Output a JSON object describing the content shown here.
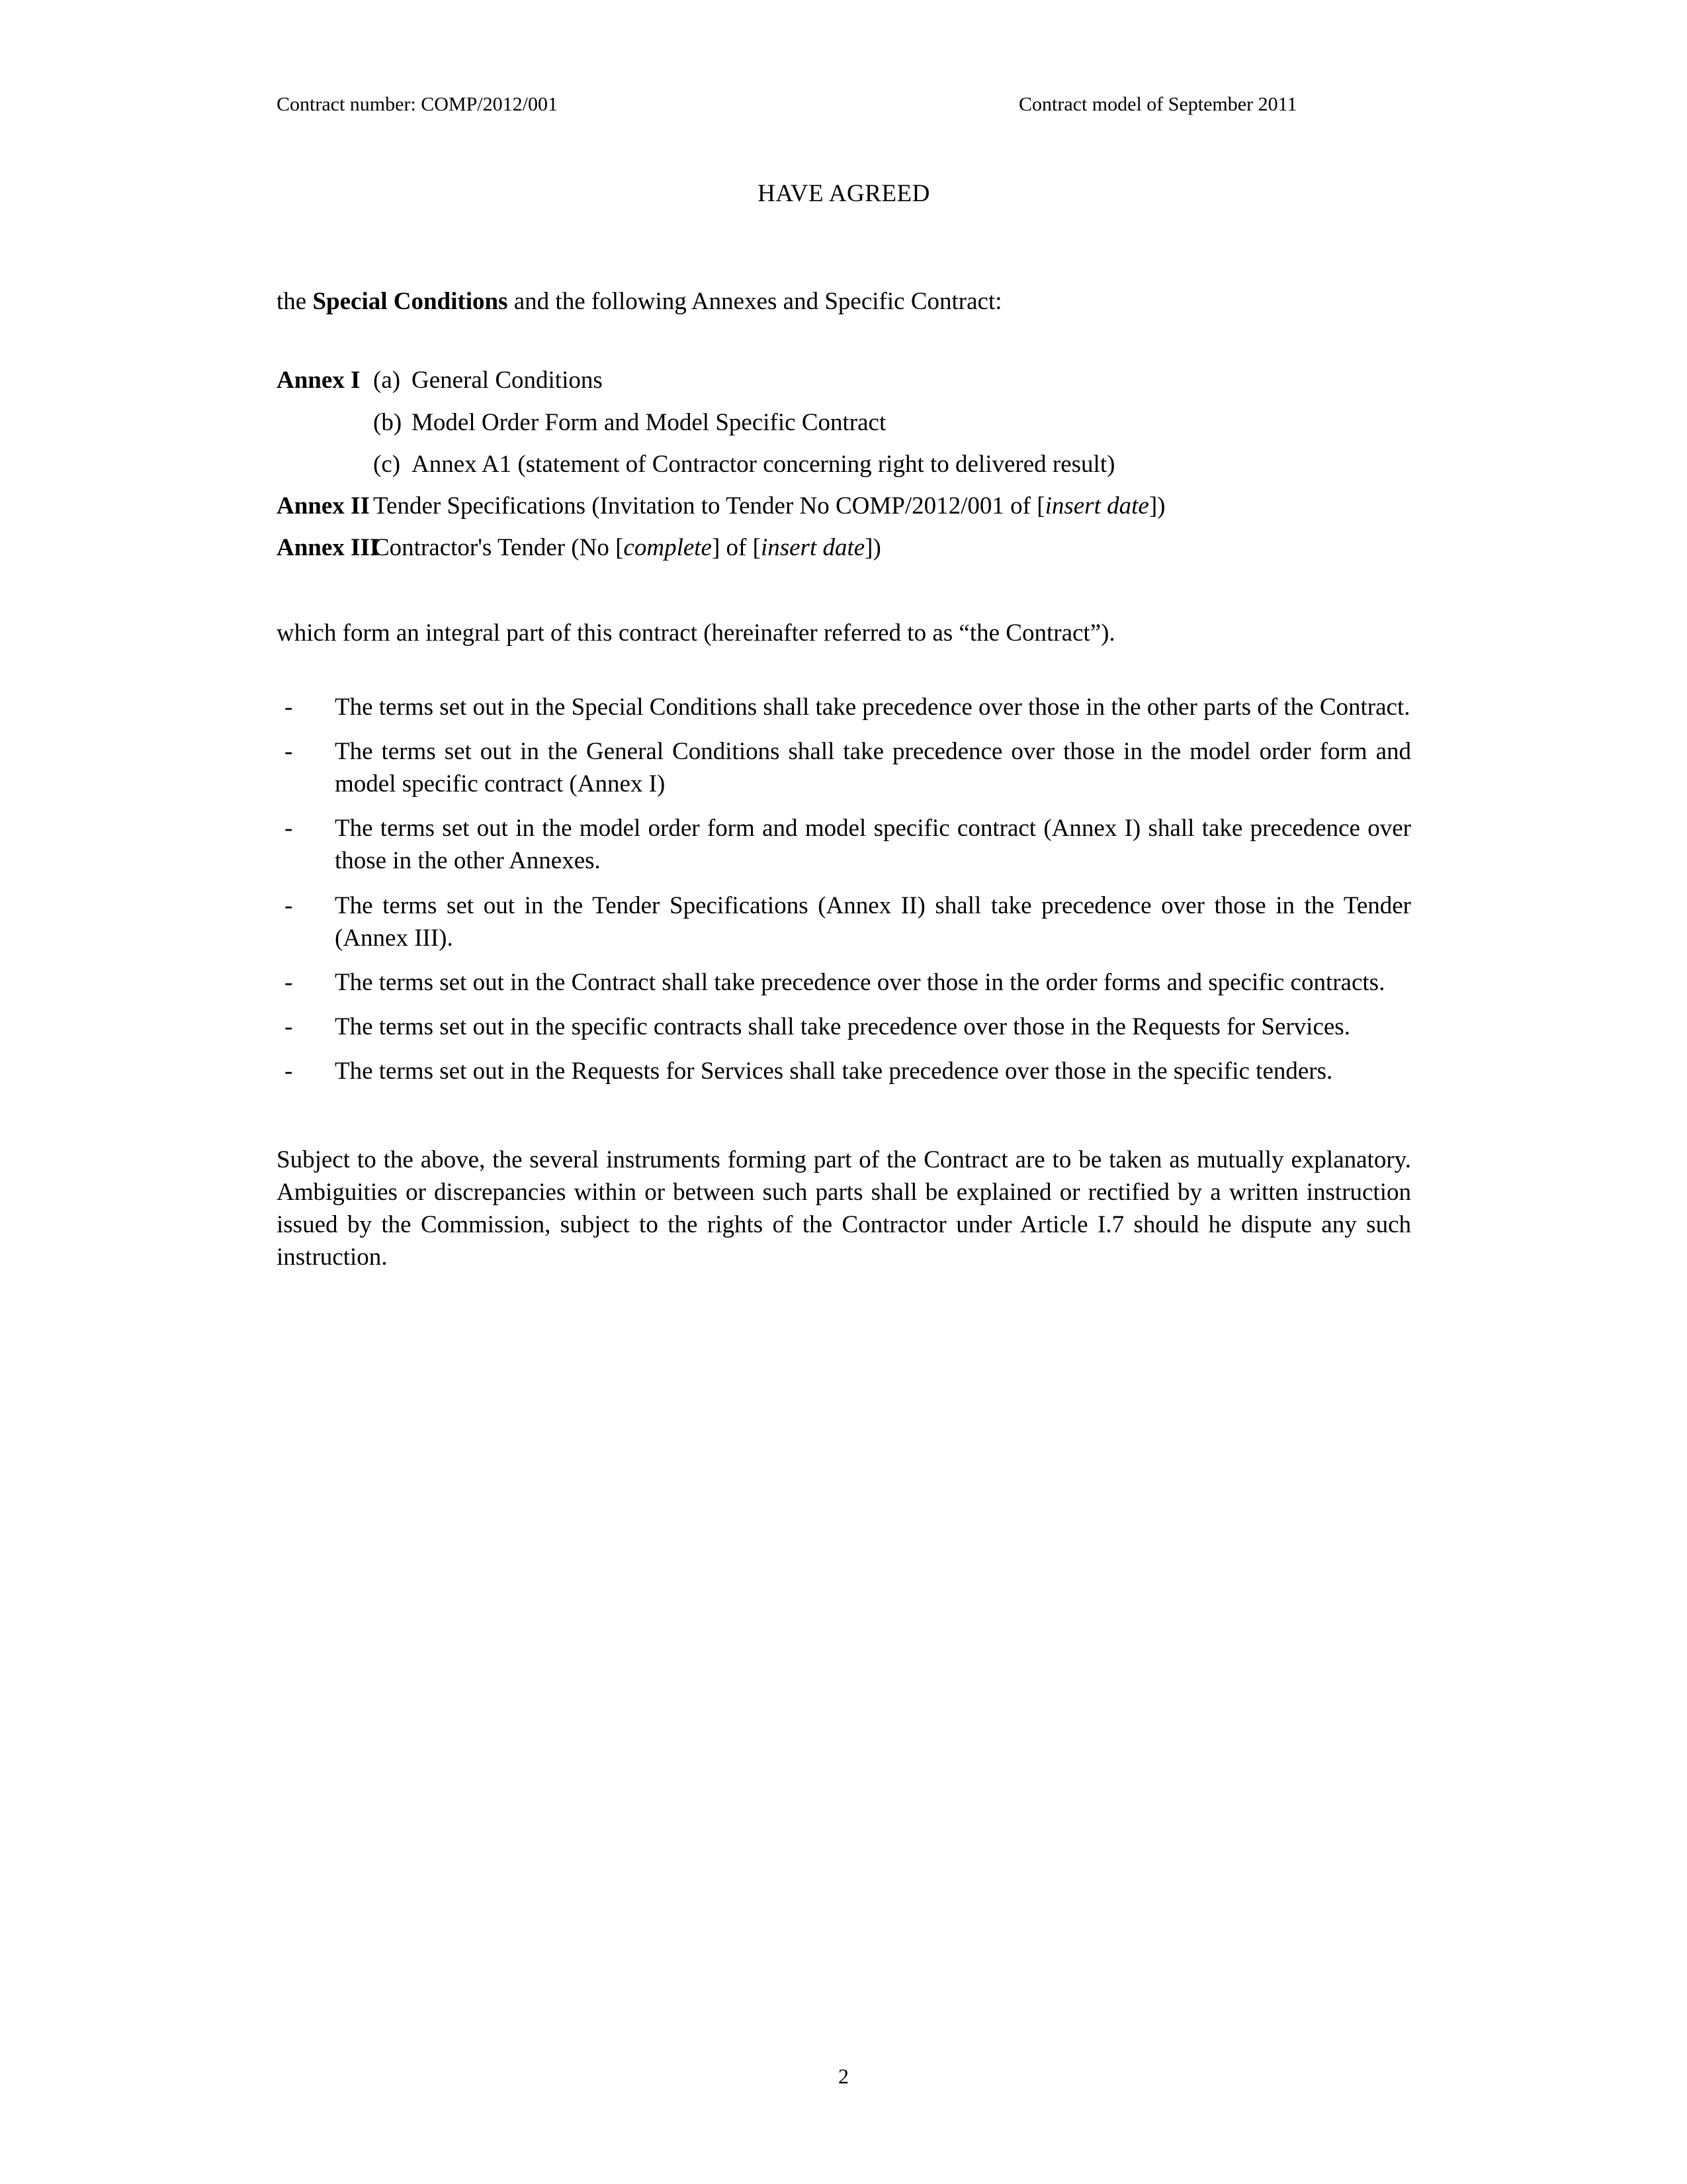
{
  "header": {
    "left": "Contract number: COMP/2012/001",
    "right": "Contract model of September 2011"
  },
  "main": {
    "title": "HAVE AGREED",
    "intro": {
      "before": "the ",
      "bold": "Special Conditions",
      "after": " and the following Annexes and Specific Contract:"
    },
    "annexes": [
      {
        "label": "Annex I",
        "subitems": [
          {
            "marker": "(a)",
            "text": "General Conditions"
          },
          {
            "marker": "(b)",
            "text": "Model Order Form and Model Specific Contract"
          },
          {
            "marker": "(c)",
            "text": "Annex A1 (statement of Contractor concerning right to delivered result)"
          }
        ]
      },
      {
        "label": "Annex II",
        "text_parts": [
          {
            "style": "normal",
            "text": "Tender Specifications (Invitation to Tender No COMP/2012/001 of ["
          },
          {
            "style": "italic",
            "text": "insert date"
          },
          {
            "style": "normal",
            "text": "])"
          }
        ]
      },
      {
        "label": "Annex III",
        "text_parts": [
          {
            "style": "normal",
            "text": "Contractor's Tender (No ["
          },
          {
            "style": "italic",
            "text": "complete"
          },
          {
            "style": "normal",
            "text": "] of ["
          },
          {
            "style": "italic",
            "text": "insert date"
          },
          {
            "style": "normal",
            "text": "])"
          }
        ]
      }
    ],
    "integral_paragraph": "which form an integral part of this contract (hereinafter referred to as “the Contract”).",
    "bullet_marker": "-",
    "bullets": [
      "The terms set out in the Special Conditions shall take precedence over those in the other parts of the Contract.",
      "The terms set out in the General Conditions shall take precedence over those in the model order form and model specific contract (Annex I)",
      "The terms set out in the model order form and model specific contract (Annex I) shall take precedence over those in the other Annexes.",
      "The terms set out in the Tender Specifications (Annex II) shall take precedence over those in the Tender (Annex III).",
      "The terms set out in the Contract shall take precedence over those in the order forms and specific contracts.",
      "The terms set out in the specific contracts shall take precedence over those in the Requests for Services.",
      "The terms set out in the Requests for Services shall take precedence over those in the specific tenders."
    ],
    "closing_paragraph": "Subject to the above, the several instruments forming part of the Contract are to be taken as mutually explanatory. Ambiguities or discrepancies within or between such parts shall be explained or rectified by a written instruction issued by the Commission, subject to the rights of the Contractor under Article I.7 should he dispute any such instruction."
  },
  "footer": {
    "page_number": "2"
  }
}
